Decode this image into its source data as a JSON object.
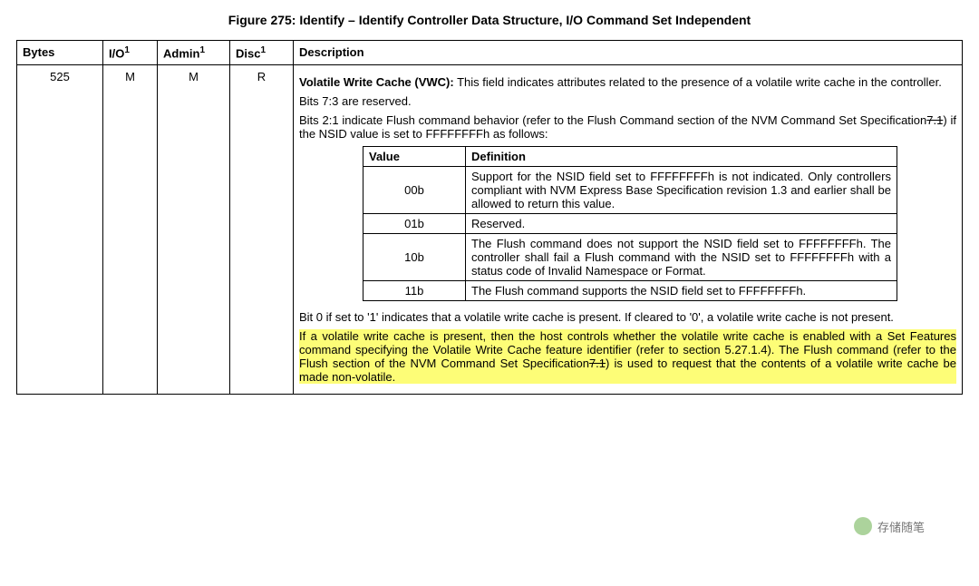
{
  "title": "Figure 275: Identify – Identify Controller Data Structure, I/O Command Set Independent",
  "headers": {
    "bytes": "Bytes",
    "io": "I/O",
    "admin": "Admin",
    "disc": "Disc",
    "description": "Description",
    "sup": "1"
  },
  "row": {
    "bytes": "525",
    "io": "M",
    "admin": "M",
    "disc": "R"
  },
  "desc": {
    "vwc_lead": "Volatile Write Cache (VWC):",
    "vwc_body": " This field indicates attributes related to the presence of a volatile write cache in the controller.",
    "reserved": "Bits 7:3 are reserved.",
    "bits21_a": "Bits 2:1 indicate Flush command behavior (refer to the Flush Command section of the NVM Command Set Specification",
    "bits21_strike": "7.1",
    "bits21_b": ") if the NSID value is set to FFFFFFFFh as follows:",
    "bit0": "Bit 0 if set to '1' indicates that a volatile write cache is present. If cleared to '0', a volatile write cache is not present.",
    "hl_a": "If a volatile write cache is present, then the host controls whether the volatile write cache is enabled with a Set Features command specifying the Volatile Write Cache feature identifier (refer to section 5.27.1.4). The Flush command (refer to the Flush section of the NVM Command Set Specification",
    "hl_strike": "7.1",
    "hl_b": ") is used to request that the contents of a volatile write cache be made non-volatile."
  },
  "inner": {
    "h_value": "Value",
    "h_def": "Definition",
    "rows": [
      {
        "value": "00b",
        "def": "Support for the NSID field set to FFFFFFFFh is not indicated. Only controllers compliant with NVM Express Base Specification revision 1.3 and earlier shall be allowed to return this value."
      },
      {
        "value": "01b",
        "def": "Reserved."
      },
      {
        "value": "10b",
        "def": "The Flush command does not support the NSID field set to FFFFFFFFh. The controller shall fail a Flush command with the NSID set to FFFFFFFFh with a status code of Invalid Namespace or Format."
      },
      {
        "value": "11b",
        "def": "The Flush command supports the NSID field set to FFFFFFFFh."
      }
    ]
  },
  "watermark": "存储随笔"
}
